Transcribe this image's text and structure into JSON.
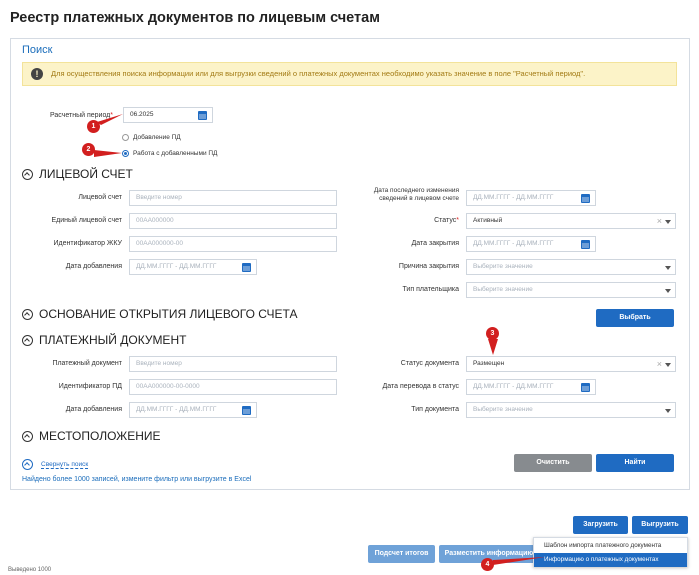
{
  "page_title": "Реестр платежных документов по лицевым счетам",
  "search": {
    "title": "Поиск",
    "alert": "Для осуществления поиска информации или для выгрузки сведений о платежных документах необходимо указать значение в поле \"Расчетный период\".",
    "period_label": "Расчетный период",
    "period_value": "06.2025",
    "radio_add": "Добавление ПД",
    "radio_work": "Работа с добавленными ПД"
  },
  "account": {
    "title": "ЛИЦЕВОЙ СЧЕТ",
    "account_label": "Лицевой счет",
    "account_ph": "Введите номер",
    "unified_label": "Единый лицевой счет",
    "unified_ph": "00АА000000",
    "gku_label": "Идентификатор ЖКУ",
    "gku_ph": "00АА000000-00",
    "added_label": "Дата добавления",
    "date_from_ph": "ДД.ММ.ГГГГ",
    "date_sep": "-",
    "date_to_ph": "ДД.ММ.ГГГГ",
    "lastchange_label_1": "Дата последнего изменения",
    "lastchange_label_2": "сведений в лицевом счете",
    "status_label": "Статус",
    "status_value": "Активный",
    "close_date_label": "Дата закрытия",
    "close_reason_label": "Причина закрытия",
    "select_ph": "Выберите значение",
    "payer_type_label": "Тип плательщика"
  },
  "basis": {
    "title": "ОСНОВАНИЕ ОТКРЫТИЯ ЛИЦЕВОГО СЧЕТА",
    "select_button": "Выбрать"
  },
  "payment": {
    "title": "ПЛАТЕЖНЫЙ ДОКУМЕНТ",
    "doc_label": "Платежный документ",
    "doc_ph": "Введите номер",
    "pd_id_label": "Идентификатор ПД",
    "pd_id_ph": "00АА000000-00-0000",
    "added_label": "Дата добавления",
    "status_label": "Статус документа",
    "status_value": "Размещен",
    "transfer_label": "Дата перевода в статус",
    "type_label": "Тип документа"
  },
  "location": {
    "title": "МЕСТОПОЛОЖЕНИЕ"
  },
  "actions": {
    "collapse": "Свернуть поиск",
    "clear": "Очистить",
    "find": "Найти",
    "found_text": "Найдено более 1000 записей, измените фильтр или выгрузите в Excel"
  },
  "bottom": {
    "upload": "Загрузить",
    "download": "Выгрузить",
    "totals": "Подсчет итогов",
    "place_info": "Разместить информацию",
    "dropdown": [
      "Шаблон импорта платежного документа",
      "Информацию о платежных документах"
    ],
    "footer_text": "Выведено 1000"
  },
  "markers": [
    "1",
    "2",
    "3",
    "4"
  ],
  "colors": {
    "accent": "#1f6bc2",
    "marker": "#d21f1f",
    "alert_bg": "#fcf3c8"
  }
}
